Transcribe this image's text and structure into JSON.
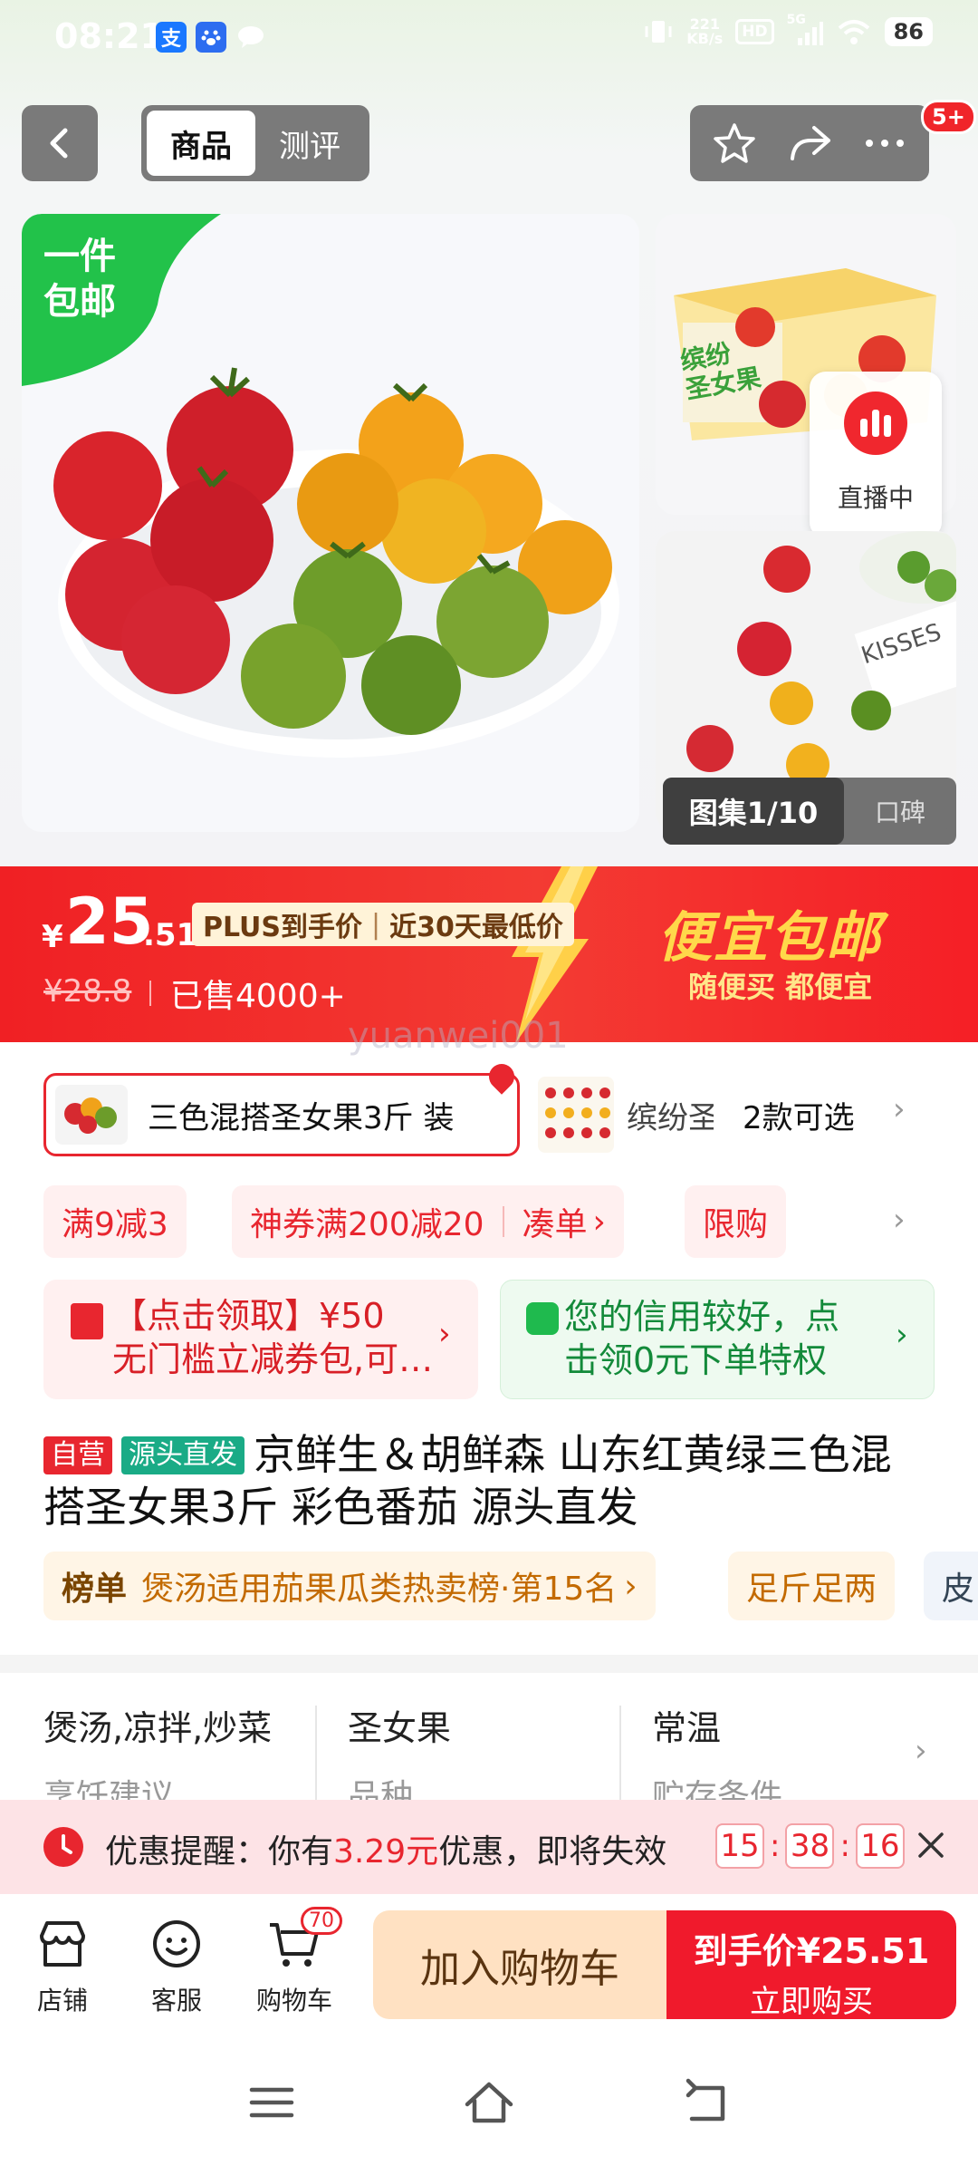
{
  "status_bar": {
    "time": "08:21",
    "net_speed_value": "221",
    "net_speed_unit": "KB/s",
    "hd": "HD",
    "signal": "5G",
    "battery": "86"
  },
  "nav": {
    "tabs": [
      "商品",
      "测评"
    ],
    "badge": "5+"
  },
  "gallery": {
    "free_shipping": [
      "一件",
      "包邮"
    ],
    "live_label": "直播中",
    "counter": "图集1/10",
    "reviews_tab": "口碑",
    "box_label": [
      "缤纷",
      "圣女果"
    ],
    "kiss_label": "KISSES"
  },
  "price": {
    "currency": "¥",
    "integer": "25",
    "decimal": ".51",
    "plus_label": "PLUS到手价",
    "low_label": "近30天最低价",
    "original": "¥28.8",
    "sold": "已售4000+",
    "promo_title": "便宜包邮",
    "promo_sub": "随便买 都便宜"
  },
  "watermark": "yuanwei001",
  "variants": {
    "selected": "三色混搭圣女果3斤 装",
    "other": "缤纷圣",
    "count": "2款可选"
  },
  "promos": {
    "a": "满9减3",
    "b": "神券满200减20",
    "b_action": "凑单",
    "c": "限购"
  },
  "coupons": {
    "red": [
      "【点击领取】¥50",
      "无门槛立减券包,可…"
    ],
    "green": [
      "您的信用较好，点",
      "击领0元下单特权"
    ]
  },
  "title": {
    "badge_self": "自营",
    "badge_source": "源头直发",
    "line1": "京鲜生＆胡鲜森 山东红黄绿三色混",
    "line2": "搭圣女果3斤 彩色番茄 源头直发"
  },
  "ranking": {
    "label": "榜单",
    "text": "煲汤适用茄果瓜类热卖榜·第15名",
    "tag2": "足斤足两",
    "tag3": "皮"
  },
  "attributes": [
    {
      "value": "煲汤,凉拌,炒菜",
      "key": "烹饪建议"
    },
    {
      "value": "圣女果",
      "key": "品种"
    },
    {
      "value": "常温",
      "key": "贮存条件"
    }
  ],
  "reminder": {
    "prefix": "优惠提醒：你有",
    "amount": "3.29元",
    "suffix": "优惠，即将失效",
    "hh": "15",
    "mm": "38",
    "ss": "16"
  },
  "actionbar": {
    "shop": "店铺",
    "service": "客服",
    "cart": "购物车",
    "cart_count": "70",
    "add_cart": "加入购物车",
    "buy_top": "到手价¥25.51",
    "buy_bottom": "立即购买"
  },
  "colors": {
    "brand_red": "#f01a2c",
    "promo_yellow": "#ffd84a",
    "green": "#1fba4e"
  }
}
